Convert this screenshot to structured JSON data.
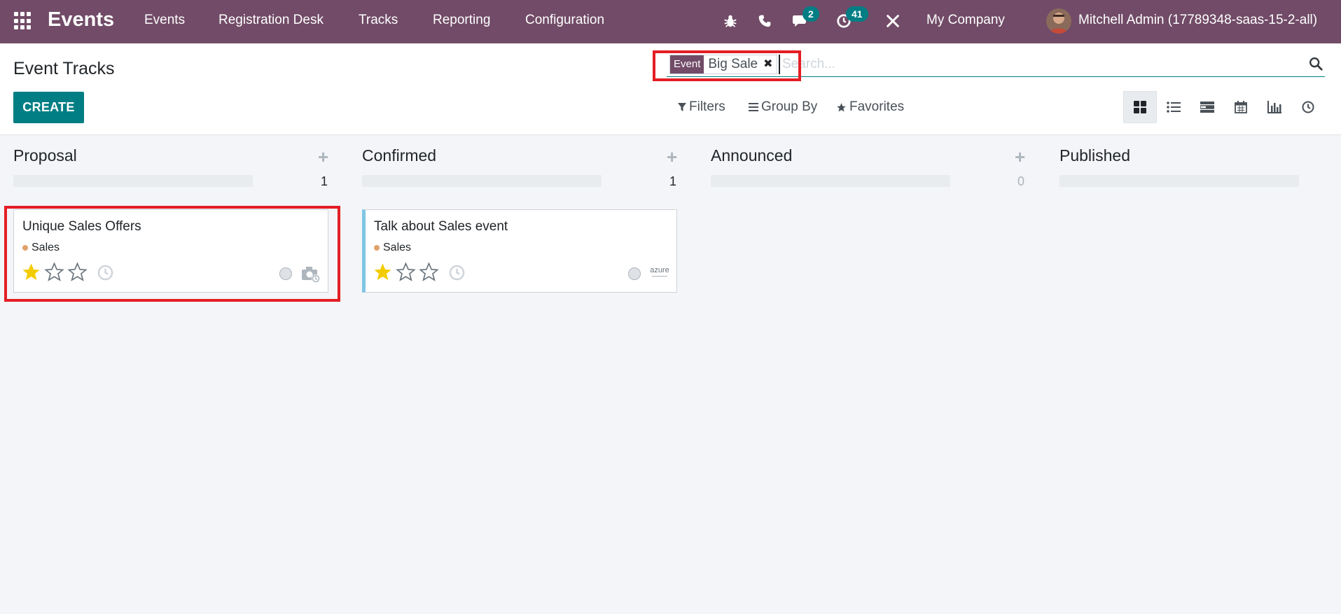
{
  "navbar": {
    "app_name": "Events",
    "menu": [
      "Events",
      "Registration Desk",
      "Tracks",
      "Reporting",
      "Configuration"
    ],
    "messages_badge": "2",
    "activities_badge": "41",
    "company": "My Company",
    "user": "Mitchell Admin (17789348-saas-15-2-all)"
  },
  "control_panel": {
    "title": "Event Tracks",
    "create_label": "CREATE",
    "search": {
      "facet_label": "Event",
      "facet_value": "Big Sale",
      "facet_remove": "✖",
      "placeholder": "Search..."
    },
    "filters_label": "Filters",
    "groupby_label": "Group By",
    "favorites_label": "Favorites",
    "views": [
      "kanban",
      "list",
      "gantt",
      "calendar",
      "graph",
      "activity"
    ],
    "active_view": "kanban"
  },
  "kanban": {
    "columns": [
      {
        "title": "Proposal",
        "count": "1",
        "add": "+",
        "cards": [
          {
            "title": "Unique Sales Offers",
            "tag": "Sales",
            "priority_stars": 1,
            "max_stars": 3,
            "image": "camera-icon"
          }
        ]
      },
      {
        "title": "Confirmed",
        "count": "1",
        "add": "+",
        "cards": [
          {
            "title": "Talk about Sales event",
            "tag": "Sales",
            "priority_stars": 1,
            "max_stars": 3,
            "image": "azure-logo",
            "logo_text": "azure"
          }
        ]
      },
      {
        "title": "Announced",
        "count": "0",
        "add": "+",
        "cards": []
      },
      {
        "title": "Published",
        "count": "",
        "add": "",
        "cards": []
      }
    ]
  },
  "colors": {
    "brand": "#714b67",
    "accent": "#017e84",
    "highlight": "#e31e24",
    "star": "#f3cc00",
    "tag": "#e0a26a",
    "card_stripe": "#7ec6e6"
  }
}
